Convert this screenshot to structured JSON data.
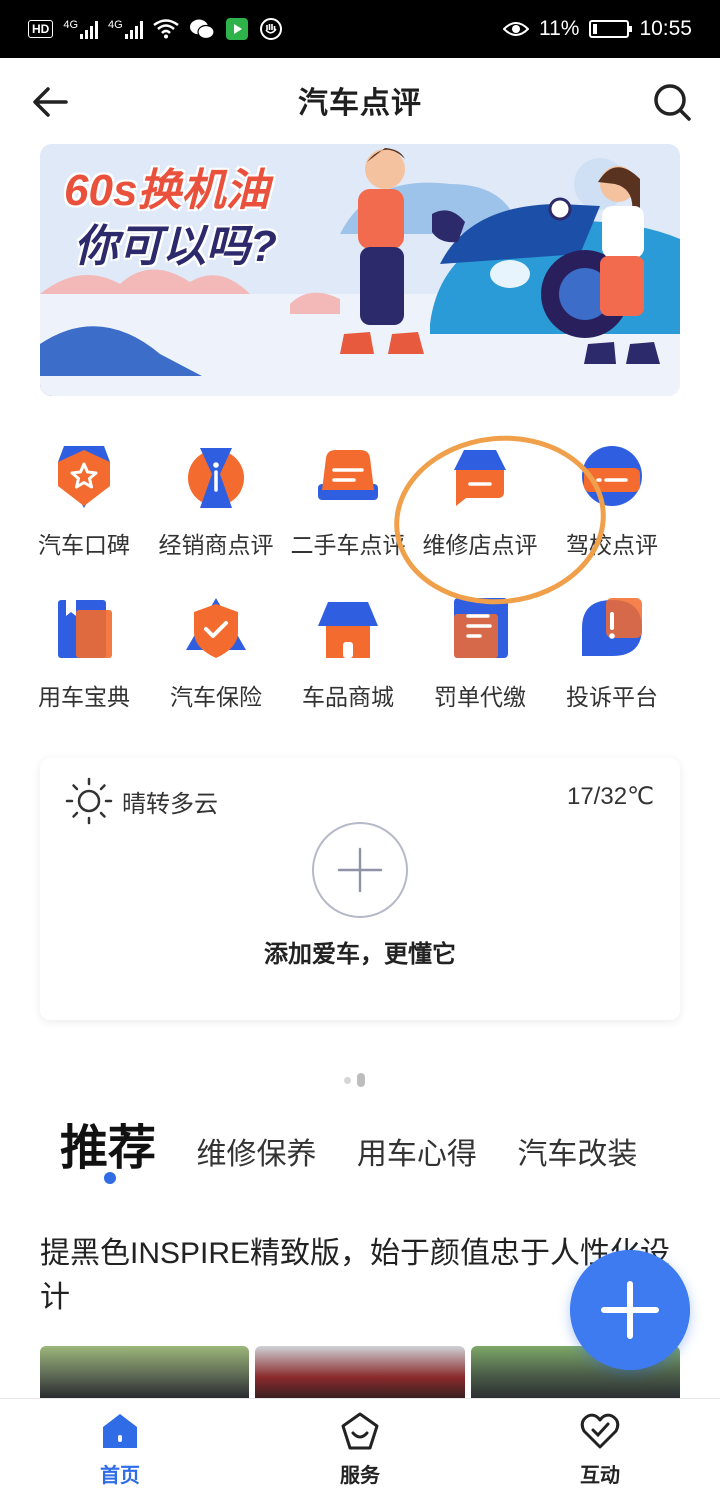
{
  "status_bar": {
    "left_badges": [
      "HD",
      "4G",
      "4G"
    ],
    "battery": "11%",
    "time": "10:55"
  },
  "header": {
    "title": "汽车点评",
    "back_icon": "back-arrow-icon",
    "search_icon": "search-icon"
  },
  "banner": {
    "line1": "60s换机油",
    "line2": "你可以吗?"
  },
  "services": [
    {
      "label": "汽车口碑",
      "icon": "badge-star-icon"
    },
    {
      "label": "经销商点评",
      "icon": "dealer-icon"
    },
    {
      "label": "二手车点评",
      "icon": "used-car-icon"
    },
    {
      "label": "维修店点评",
      "icon": "repair-shop-icon"
    },
    {
      "label": "驾校点评",
      "icon": "driving-school-icon"
    },
    {
      "label": "用车宝典",
      "icon": "book-icon"
    },
    {
      "label": "汽车保险",
      "icon": "shield-check-icon"
    },
    {
      "label": "车品商城",
      "icon": "shop-icon"
    },
    {
      "label": "罚单代缴",
      "icon": "ticket-icon"
    },
    {
      "label": "投诉平台",
      "icon": "complaint-icon"
    }
  ],
  "car_card": {
    "weather": "晴转多云",
    "temperature": "17/32℃",
    "add_text": "添加爱车，更懂它"
  },
  "tabs": [
    "推荐",
    "维修保养",
    "用车心得",
    "汽车改装"
  ],
  "article": {
    "title": "提黑色INSPIRE精致版，始于颜值忠于人性化设计"
  },
  "bottom_nav": [
    {
      "label": "首页",
      "icon": "home-icon",
      "active": true
    },
    {
      "label": "服务",
      "icon": "service-icon",
      "active": false
    },
    {
      "label": "互动",
      "icon": "interact-icon",
      "active": false
    }
  ],
  "colors": {
    "accent": "#2f6ce5",
    "highlight_ring": "#f0a04a",
    "icon_orange": "#f36b2e",
    "icon_blue": "#2f5fe0"
  }
}
